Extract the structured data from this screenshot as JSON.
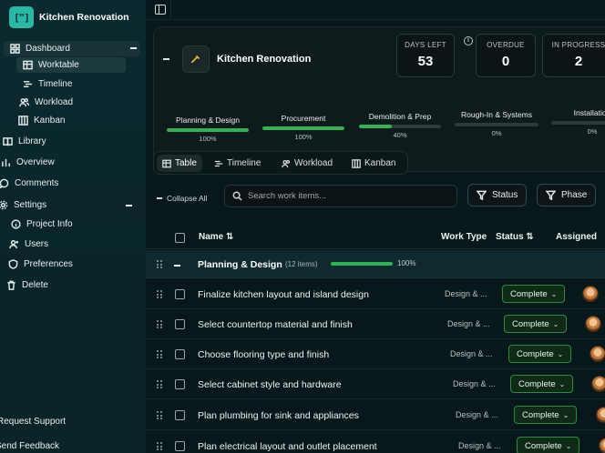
{
  "app": {
    "title": "Kitchen Renovation",
    "logo_text": "[\"]"
  },
  "sidebar": {
    "dashboard": "Dashboard",
    "dashboard_items": [
      {
        "label": "Worktable",
        "icon": "table-icon"
      },
      {
        "label": "Timeline",
        "icon": "timeline-icon"
      },
      {
        "label": "Workload",
        "icon": "users-icon"
      },
      {
        "label": "Kanban",
        "icon": "kanban-icon"
      }
    ],
    "library": "Library",
    "overview": "Overview",
    "comments": "Comments",
    "settings": "Settings",
    "settings_items": [
      {
        "label": "Project Info",
        "icon": "info-icon"
      },
      {
        "label": "Users",
        "icon": "users-icon"
      },
      {
        "label": "Preferences",
        "icon": "shield-icon"
      },
      {
        "label": "Delete",
        "icon": "trash-icon"
      }
    ],
    "request_support": "Request Support",
    "send_feedback": "Send Feedback"
  },
  "project": {
    "name": "Kitchen Renovation",
    "stats": [
      {
        "label": "DAYS LEFT",
        "value": "53"
      },
      {
        "label": "OVERDUE",
        "value": "0"
      },
      {
        "label": "IN PROGRESS",
        "value": "2"
      }
    ],
    "phases": [
      {
        "name": "Planning & Design",
        "pct_label": "100%",
        "progress": 1.0
      },
      {
        "name": "Procurement",
        "pct_label": "100%",
        "progress": 1.0
      },
      {
        "name": "Demolition & Prep",
        "pct_label": "40%",
        "progress": 0.4
      },
      {
        "name": "Rough-In & Systems",
        "pct_label": "0%",
        "progress": 0.0
      },
      {
        "name": "Installation",
        "pct_label": "0%",
        "progress": 0.0
      }
    ]
  },
  "view_tabs": [
    "Table",
    "Timeline",
    "Workload",
    "Kanban"
  ],
  "toolbar": {
    "collapse_all": "Collapse All",
    "search_placeholder": "Search work items...",
    "status_filter": "Status",
    "phase_filter": "Phase"
  },
  "table": {
    "columns": [
      "Name",
      "Work Type",
      "Status",
      "Assigned"
    ],
    "group": {
      "name": "Planning & Design",
      "count": "(12 items)",
      "pct_label": "100%"
    },
    "rows": [
      {
        "name": "Finalize kitchen layout and island design",
        "work_type": "Design & ...",
        "status": "Complete"
      },
      {
        "name": "Select countertop material and finish",
        "work_type": "Design & ...",
        "status": "Complete"
      },
      {
        "name": "Choose flooring type and finish",
        "work_type": "Design & ...",
        "status": "Complete"
      },
      {
        "name": "Select cabinet style and hardware",
        "work_type": "Design & ...",
        "status": "Complete"
      },
      {
        "name": "Plan plumbing for sink and appliances",
        "work_type": "Design & ...",
        "status": "Complete"
      },
      {
        "name": "Plan electrical layout and outlet placement",
        "work_type": "Design & ...",
        "status": "Complete"
      }
    ]
  },
  "colors": {
    "accent": "#27b8a6",
    "progress_green": "#2fb455",
    "sidebar_bg": "#0b2a2f"
  }
}
